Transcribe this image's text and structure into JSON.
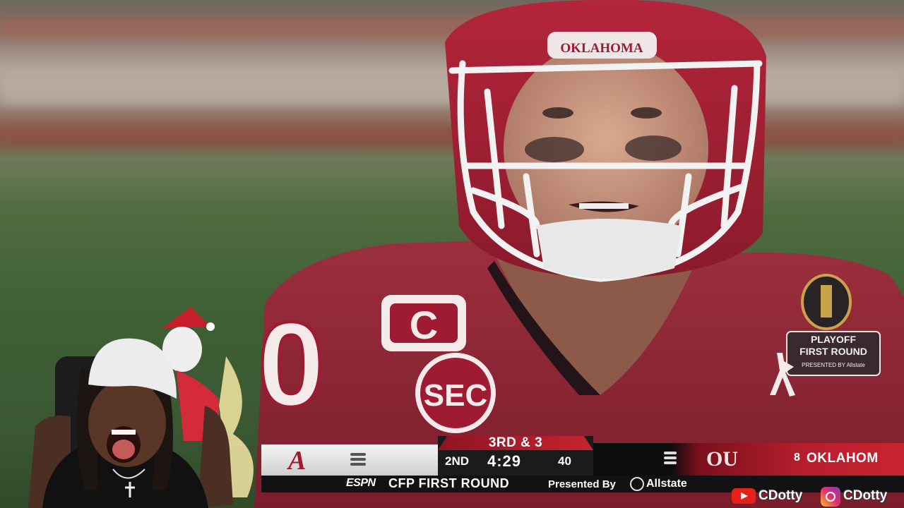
{
  "helmet": {
    "text": "OKLAHOMA"
  },
  "jersey": {
    "captain_patch": "C",
    "sec_patch": "SEC",
    "number": "0",
    "badge_line1": "PLAYOFF",
    "badge_line2": "FIRST ROUND",
    "badge_line3": "PRESENTED BY Allstate"
  },
  "scorebug": {
    "away_logo": "A",
    "down_distance": "3RD & 3",
    "quarter": "2ND",
    "clock": "4:29",
    "play_clock": "40",
    "home_logo": "OU",
    "home_rank": "8",
    "home_name": "OKLAHOM"
  },
  "bottom_bar": {
    "network": "ESPN",
    "title": "CFP FIRST ROUND",
    "presented_by": "Presented By",
    "sponsor": "Allstate"
  },
  "handles": {
    "youtube": "CDotty",
    "instagram": "CDotty"
  },
  "colors": {
    "crimson": "#9e1b32",
    "scorebug_dark": "#1b1b1d",
    "ou_red": "#c8242f"
  }
}
